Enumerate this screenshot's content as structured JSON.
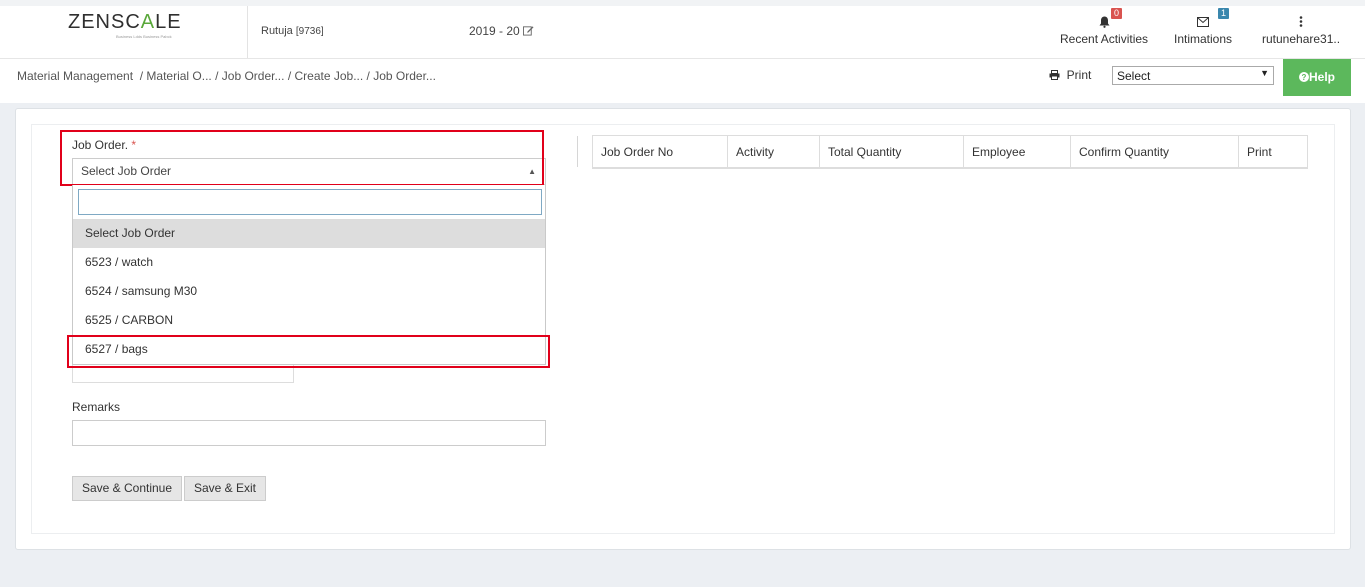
{
  "header": {
    "logo": {
      "part1": "ZEN",
      "part2": "SC",
      "accent": "A",
      "part3": "LE",
      "tagline": "Business Ldds Business Pabck"
    },
    "user": "Rutuja",
    "user_code": "[9736]",
    "year": "2019 - 20",
    "recent_activities": {
      "label": "Recent Activities",
      "count": "0",
      "icon": "bell-icon"
    },
    "intimations": {
      "label": "Intimations",
      "count": "1",
      "icon": "envelope-icon"
    },
    "account": {
      "label": "rutunehare31..",
      "icon": "vertical-dots-icon"
    }
  },
  "breadcrumb": {
    "items": [
      "Material Management",
      "/ Material O...",
      "/ Job Order...",
      "/ Create Job...",
      "/ Job Order..."
    ]
  },
  "toolbar": {
    "print_label": "Print",
    "select_value": "Select",
    "help_label": "Help"
  },
  "form": {
    "job_order_label": "Job Order.",
    "required_mark": "*",
    "job_order_selected": "Select Job Order",
    "search_value": "",
    "options": [
      "Select Job Order",
      "6523 / watch",
      "6524 / samsung M30",
      "6525 / CARBON",
      "6527 / bags"
    ],
    "selected_option_index": 0,
    "remarks_label": "Remarks",
    "remarks_value": "",
    "save_continue_label": "Save & Continue",
    "save_exit_label": "Save & Exit"
  },
  "table": {
    "columns": [
      "Job Order No",
      "Activity",
      "Total Quantity",
      "Employee",
      "Confirm Quantity",
      "Print"
    ]
  },
  "colors": {
    "help_green": "#5cb85c",
    "highlight_red": "#e1001a",
    "badge_red": "#d9534f",
    "badge_blue": "#3a87ad",
    "logo_green": "#5aa83a"
  }
}
